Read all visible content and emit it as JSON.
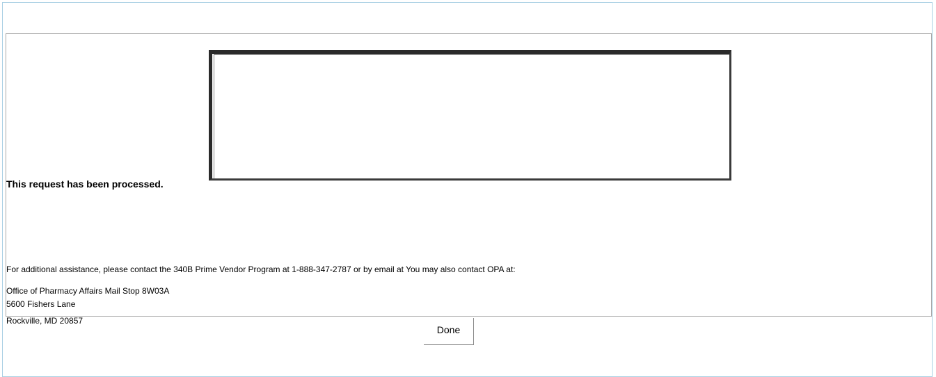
{
  "message": {
    "processed": "This request has been processed."
  },
  "assistance": {
    "text": "For additional assistance, please contact the 340B Prime Vendor Program at 1-888-347-2787 or by email at  You may also contact OPA at:"
  },
  "address": {
    "line1": "Office of Pharmacy Affairs Mail Stop 8W03A",
    "line2": "5600 Fishers Lane",
    "line3": "Rockville, MD 20857"
  },
  "actions": {
    "done_label": "Done"
  },
  "colors": {
    "frame_border": "#a8cfe3",
    "panel_border": "#a9a9a9",
    "box_border": "#2a2a2a"
  }
}
